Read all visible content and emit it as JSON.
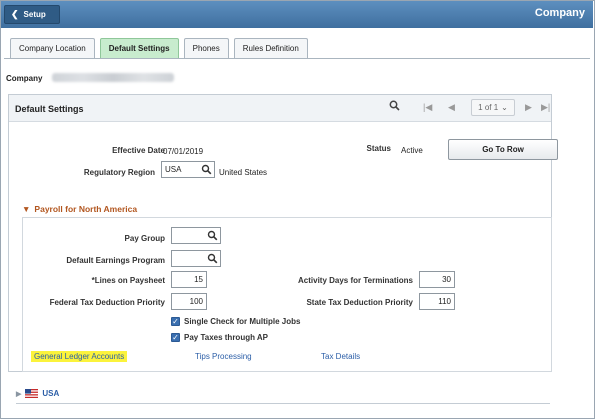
{
  "header": {
    "back_label": "Setup",
    "page_title": "Company"
  },
  "tabs": [
    {
      "label": "Company Location"
    },
    {
      "label": "Default Settings"
    },
    {
      "label": "Phones"
    },
    {
      "label": "Rules Definition"
    }
  ],
  "company": {
    "label": "Company"
  },
  "box": {
    "title": "Default Settings",
    "pager_text": "1 of 1"
  },
  "fields": {
    "effective_date_label": "Effective Date",
    "effective_date_value": "07/01/2019",
    "status_label": "Status",
    "status_value": "Active",
    "goto_label": "Go To Row",
    "regulatory_region_label": "Regulatory Region",
    "regulatory_region_value": "USA",
    "regulatory_region_desc": "United States"
  },
  "payroll": {
    "title": "Payroll for North America",
    "pay_group_label": "Pay Group",
    "pay_group_value": "",
    "default_earnings_label": "Default Earnings Program",
    "default_earnings_value": "",
    "lines_on_paysheet_label": "*Lines on Paysheet",
    "lines_on_paysheet_value": "15",
    "activity_days_label": "Activity Days for Terminations",
    "activity_days_value": "30",
    "federal_tax_label": "Federal Tax Deduction Priority",
    "federal_tax_value": "100",
    "state_tax_label": "State Tax Deduction Priority",
    "state_tax_value": "110",
    "single_check_label": "Single Check for Multiple Jobs",
    "single_check_checked": true,
    "pay_taxes_label": "Pay Taxes through AP",
    "pay_taxes_checked": true,
    "link_gl": "General Ledger Accounts",
    "link_tips": "Tips Processing",
    "link_tax": "Tax Details"
  },
  "usa_section": {
    "label": "USA"
  },
  "colors": {
    "header_blue": "#4a7cad",
    "active_tab": "#c8ecce",
    "section_title": "#b2561f",
    "link": "#2b5ea7",
    "highlight": "#fbf33c"
  }
}
